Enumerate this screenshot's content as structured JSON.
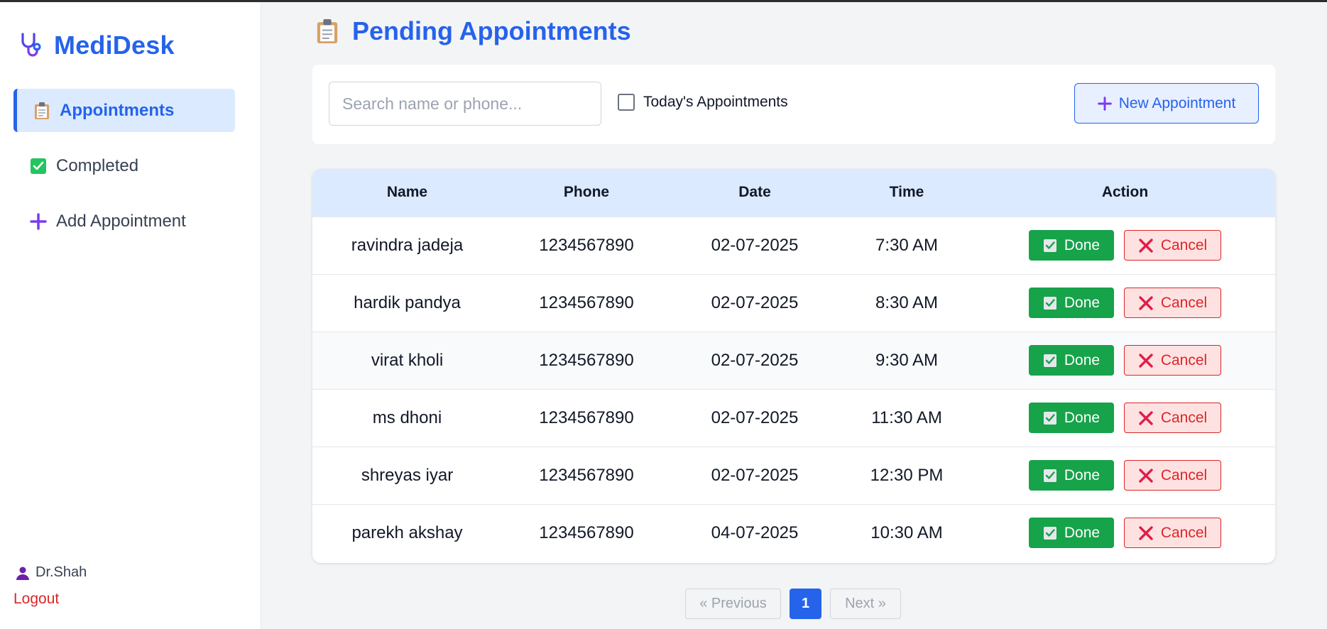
{
  "brand": {
    "name": "MediDesk",
    "icon": "stethoscope-icon"
  },
  "sidebar": {
    "items": [
      {
        "label": "Appointments",
        "icon": "clipboard-icon",
        "active": true
      },
      {
        "label": "Completed",
        "icon": "check-box-icon",
        "active": false
      },
      {
        "label": "Add Appointment",
        "icon": "plus-icon",
        "active": false
      }
    ],
    "user": "Dr.Shah",
    "logout": "Logout"
  },
  "page": {
    "title": "Pending Appointments"
  },
  "toolbar": {
    "search_placeholder": "Search name or phone...",
    "search_value": "",
    "today_label": "Today's Appointments",
    "today_checked": false,
    "new_button": "New Appointment"
  },
  "table": {
    "headers": [
      "Name",
      "Phone",
      "Date",
      "Time",
      "Action"
    ],
    "rows": [
      {
        "name": "ravindra jadeja",
        "phone": "1234567890",
        "date": "02-07-2025",
        "time": "7:30 AM"
      },
      {
        "name": "hardik pandya",
        "phone": "1234567890",
        "date": "02-07-2025",
        "time": "8:30 AM"
      },
      {
        "name": "virat kholi",
        "phone": "1234567890",
        "date": "02-07-2025",
        "time": "9:30 AM"
      },
      {
        "name": "ms dhoni",
        "phone": "1234567890",
        "date": "02-07-2025",
        "time": "11:30 AM"
      },
      {
        "name": "shreyas iyar",
        "phone": "1234567890",
        "date": "02-07-2025",
        "time": "12:30 PM"
      },
      {
        "name": "parekh akshay",
        "phone": "1234567890",
        "date": "04-07-2025",
        "time": "10:30 AM"
      }
    ],
    "done_label": "Done",
    "cancel_label": "Cancel"
  },
  "pagination": {
    "prev": "« Previous",
    "current": "1",
    "next": "Next »"
  },
  "colors": {
    "accent": "#2563eb",
    "success": "#16a34a",
    "danger": "#dc2626",
    "header_bg": "#dbeafe"
  }
}
